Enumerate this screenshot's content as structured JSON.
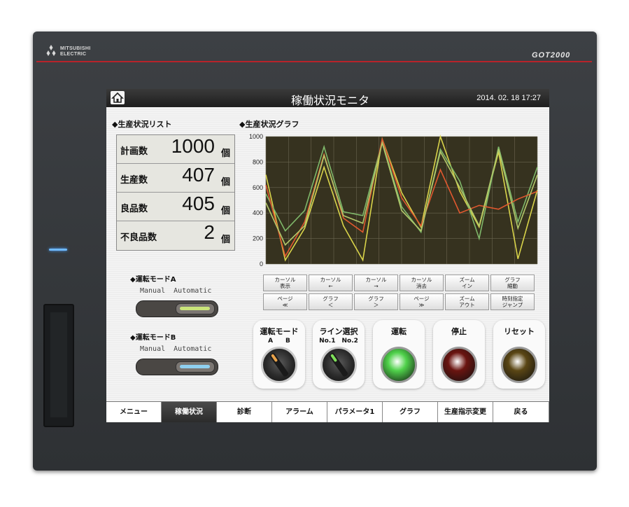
{
  "device": {
    "brand": "MITSUBISHI\nELECTRIC",
    "model": "GOT2000"
  },
  "header": {
    "title": "稼働状況モニタ",
    "datetime": "2014. 02. 18  17:27"
  },
  "production_list": {
    "title": "◆生産状況リスト",
    "rows": [
      {
        "label": "計画数",
        "value": "1000",
        "unit": "個"
      },
      {
        "label": "生産数",
        "value": "407",
        "unit": "個"
      },
      {
        "label": "良品数",
        "value": "405",
        "unit": "個"
      },
      {
        "label": "不良品数",
        "value": "2",
        "unit": "個"
      }
    ]
  },
  "graph": {
    "title": "◆生産状況グラフ",
    "buttons_row1": [
      {
        "line1": "カーソル",
        "line2": "表示"
      },
      {
        "line1": "カーソル",
        "line2": "←"
      },
      {
        "line1": "カーソル",
        "line2": "→"
      },
      {
        "line1": "カーソル",
        "line2": "消去"
      },
      {
        "line1": "ズーム",
        "line2": "イン"
      },
      {
        "line1": "グラフ",
        "line2": "縮動"
      }
    ],
    "buttons_row2": [
      {
        "line1": "ページ",
        "line2": "≪"
      },
      {
        "line1": "グラフ",
        "line2": "＜"
      },
      {
        "line1": "グラフ",
        "line2": "＞"
      },
      {
        "line1": "ページ",
        "line2": "≫"
      },
      {
        "line1": "ズーム",
        "line2": "アウト"
      },
      {
        "line1": "時刻指定",
        "line2": "ジャンプ"
      }
    ]
  },
  "chart_data": {
    "type": "line",
    "ylim": [
      0,
      1000
    ],
    "yticks": [
      "0",
      "200",
      "400",
      "600",
      "800",
      "1000"
    ],
    "x": [
      0,
      1,
      2,
      3,
      4,
      5,
      6,
      7,
      8,
      9,
      10,
      11,
      12,
      13,
      14
    ],
    "series": [
      {
        "color": "#d9d44a",
        "values": [
          700,
          30,
          280,
          760,
          300,
          30,
          980,
          560,
          290,
          1000,
          570,
          290,
          880,
          40,
          580
        ]
      },
      {
        "color": "#7fb86a",
        "values": [
          550,
          260,
          420,
          920,
          410,
          380,
          960,
          450,
          250,
          900,
          650,
          200,
          920,
          330,
          760
        ]
      },
      {
        "color": "#e0582f",
        "values": [
          620,
          60,
          330,
          860,
          360,
          250,
          980,
          520,
          300,
          740,
          400,
          460,
          430,
          510,
          570
        ]
      },
      {
        "color": "#b2c86a",
        "values": [
          480,
          150,
          300,
          850,
          380,
          320,
          950,
          420,
          260,
          880,
          600,
          300,
          900,
          280,
          700
        ]
      }
    ],
    "grid": true
  },
  "mode_a": {
    "title": "◆運転モードA",
    "left": "Manual",
    "right": "Automatic",
    "light_color": "#c9e47a"
  },
  "mode_b": {
    "title": "◆運転モードB",
    "left": "Manual",
    "right": "Automatic",
    "light_color": "#8fd0f0"
  },
  "controls": [
    {
      "title": "運転モード",
      "sub": "A　　B",
      "kind": "selector",
      "accent": "#e8a24a"
    },
    {
      "title": "ライン選択",
      "sub": "No.1　No.2",
      "kind": "selector",
      "accent": "#7fe05a"
    },
    {
      "title": "運転",
      "sub": "",
      "kind": "lamp",
      "color": "#4fd14a"
    },
    {
      "title": "停止",
      "sub": "",
      "kind": "lamp",
      "color": "#6a1410"
    },
    {
      "title": "リセット",
      "sub": "",
      "kind": "lamp",
      "color": "#5a4614"
    }
  ],
  "tabs": [
    {
      "label": "メニュー"
    },
    {
      "label": "稼働状況"
    },
    {
      "label": "診断"
    },
    {
      "label": "アラーム"
    },
    {
      "label": "パラメータ1"
    },
    {
      "label": "グラフ"
    },
    {
      "label": "生産指示変更"
    },
    {
      "label": "戻る"
    }
  ],
  "active_tab": 1
}
